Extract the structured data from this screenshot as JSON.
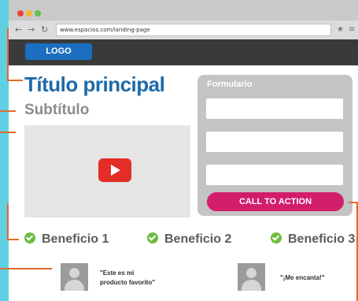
{
  "browser": {
    "url": "www.espacios.com/landing-page",
    "back_icon": "←",
    "forward_icon": "→",
    "reload_icon": "↻",
    "star_icon": "★",
    "menu_icon": "≡"
  },
  "header": {
    "logo": "LOGO"
  },
  "content": {
    "title": "Título principal",
    "subtitle": "Subtítulo"
  },
  "form": {
    "label": "Formulario",
    "cta": "CALL TO ACTION"
  },
  "benefits": [
    {
      "label": "Beneficio 1"
    },
    {
      "label": "Beneficio 2"
    },
    {
      "label": "Beneficio 3"
    }
  ],
  "testimonials": [
    {
      "line1": "\"Este es mi",
      "line2": "producto favorito\""
    },
    {
      "line1": "\"¡Me encanta!\""
    }
  ],
  "colors": {
    "background": "#5ed0e2",
    "title": "#1e6aa8",
    "cta": "#d21d6b",
    "check": "#6dbc3f",
    "annotation": "#e26a2c"
  }
}
